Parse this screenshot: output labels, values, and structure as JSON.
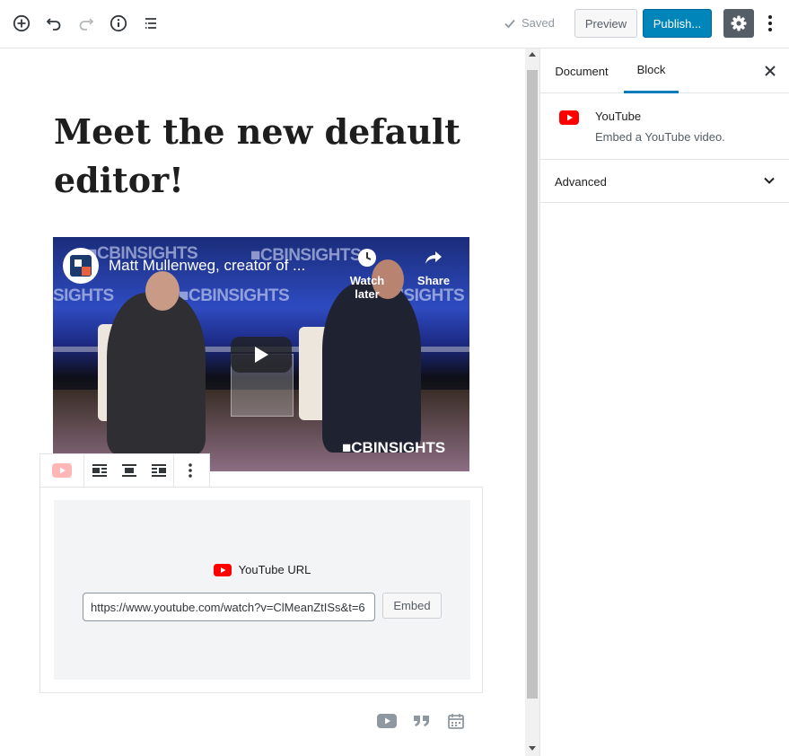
{
  "toolbar": {
    "saved_label": "Saved",
    "preview_label": "Preview",
    "publish_label": "Publish...",
    "icons": [
      "add-block-icon",
      "undo-icon",
      "redo-icon",
      "info-icon",
      "outline-icon",
      "check-icon",
      "gear-icon",
      "more-vertical-icon"
    ],
    "accent_color": "#0085ba"
  },
  "editor": {
    "title": "Meet the new default editor!",
    "video": {
      "title": "Matt Mullenweg, creator of ...",
      "watch_later": "Watch later",
      "share": "Share",
      "brand_watermark": "CBINSIGHTS"
    },
    "embed": {
      "label": "YouTube URL",
      "url_value": "https://www.youtube.com/watch?v=ClMeanZtISs&t=6",
      "embed_button": "Embed"
    }
  },
  "sidebar": {
    "tabs": [
      "Document",
      "Block"
    ],
    "active_tab": "Block",
    "block": {
      "name": "YouTube",
      "description": "Embed a YouTube video."
    },
    "panels": [
      {
        "label": "Advanced",
        "expanded": false
      }
    ]
  }
}
